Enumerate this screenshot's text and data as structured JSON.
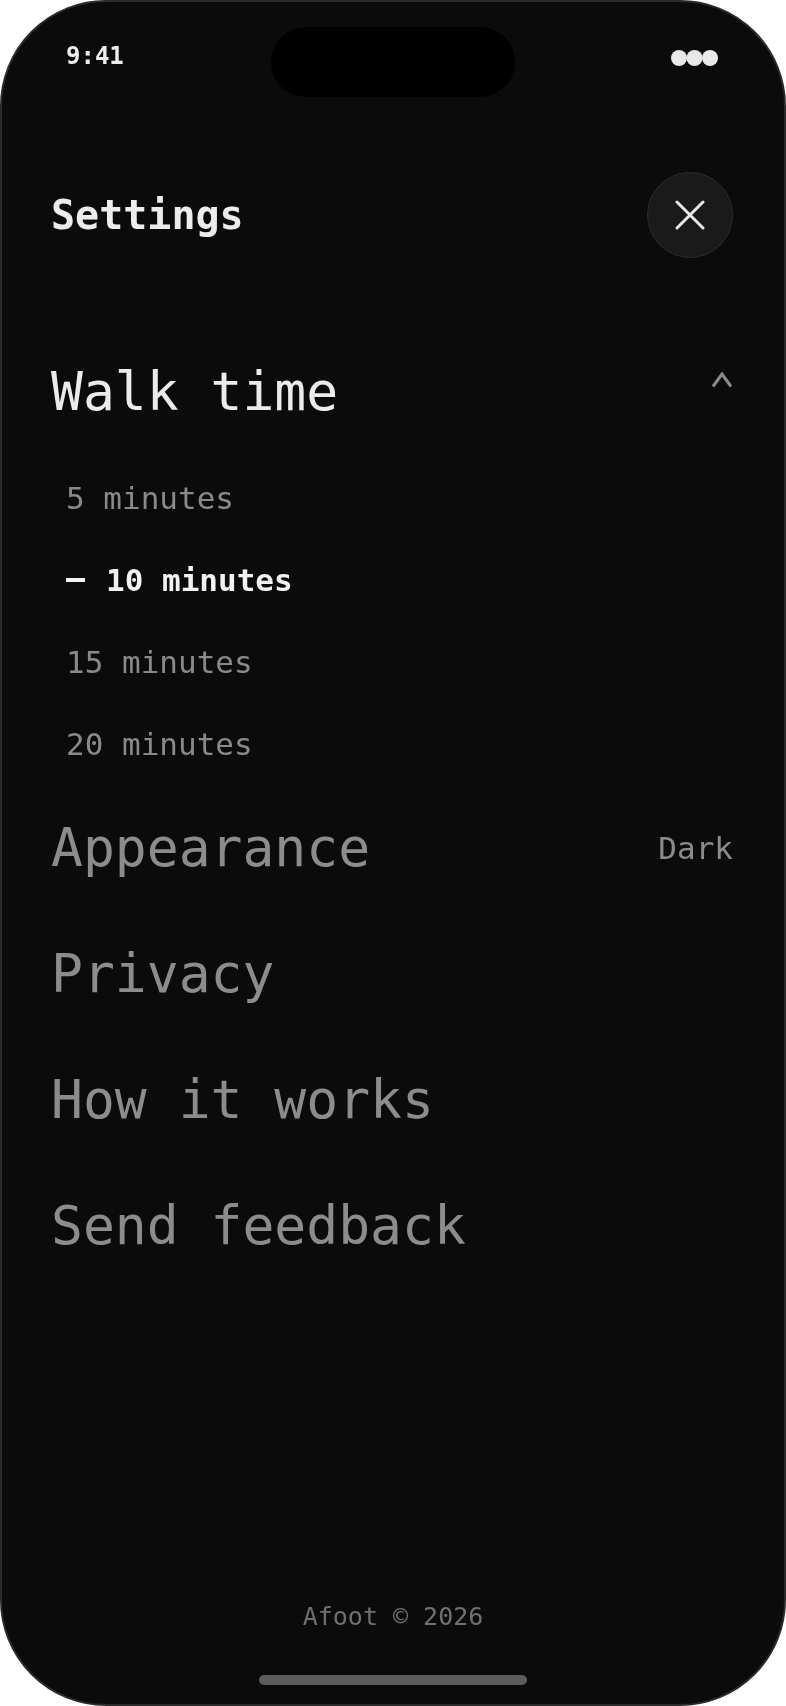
{
  "status_bar": {
    "time": "9:41"
  },
  "header": {
    "title": "Settings"
  },
  "sections": [
    {
      "kind": "accordion",
      "label": "Walk time",
      "expanded": true,
      "options": [
        {
          "label": "5 minutes",
          "selected": false
        },
        {
          "label": "10 minutes",
          "selected": true
        },
        {
          "label": "15 minutes",
          "selected": false
        },
        {
          "label": "20 minutes",
          "selected": false
        }
      ]
    },
    {
      "kind": "link",
      "label": "Appearance",
      "value": "Dark"
    },
    {
      "kind": "link",
      "label": "Privacy"
    },
    {
      "kind": "link",
      "label": "How it works"
    },
    {
      "kind": "link",
      "label": "Send feedback"
    }
  ],
  "footer": {
    "text": "Afoot © 2026"
  }
}
